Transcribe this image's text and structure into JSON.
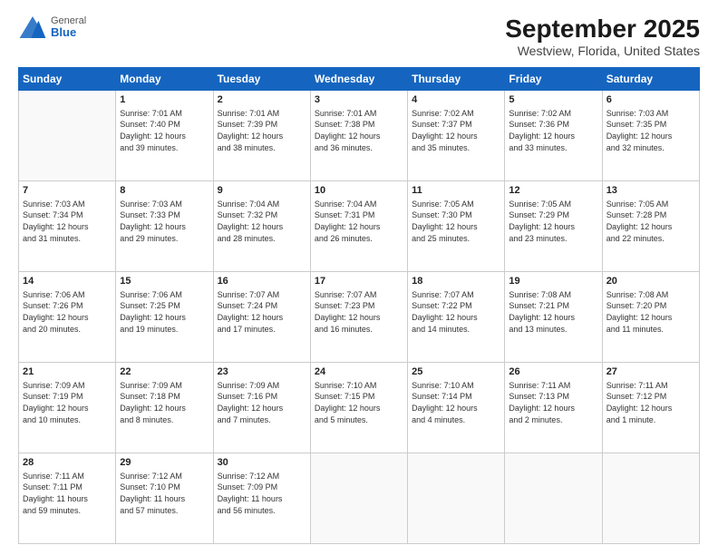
{
  "logo": {
    "general": "General",
    "blue": "Blue"
  },
  "header": {
    "title": "September 2025",
    "subtitle": "Westview, Florida, United States"
  },
  "days": [
    "Sunday",
    "Monday",
    "Tuesday",
    "Wednesday",
    "Thursday",
    "Friday",
    "Saturday"
  ],
  "weeks": [
    [
      {
        "day": "",
        "content": ""
      },
      {
        "day": "1",
        "content": "Sunrise: 7:01 AM\nSunset: 7:40 PM\nDaylight: 12 hours\nand 39 minutes."
      },
      {
        "day": "2",
        "content": "Sunrise: 7:01 AM\nSunset: 7:39 PM\nDaylight: 12 hours\nand 38 minutes."
      },
      {
        "day": "3",
        "content": "Sunrise: 7:01 AM\nSunset: 7:38 PM\nDaylight: 12 hours\nand 36 minutes."
      },
      {
        "day": "4",
        "content": "Sunrise: 7:02 AM\nSunset: 7:37 PM\nDaylight: 12 hours\nand 35 minutes."
      },
      {
        "day": "5",
        "content": "Sunrise: 7:02 AM\nSunset: 7:36 PM\nDaylight: 12 hours\nand 33 minutes."
      },
      {
        "day": "6",
        "content": "Sunrise: 7:03 AM\nSunset: 7:35 PM\nDaylight: 12 hours\nand 32 minutes."
      }
    ],
    [
      {
        "day": "7",
        "content": "Sunrise: 7:03 AM\nSunset: 7:34 PM\nDaylight: 12 hours\nand 31 minutes."
      },
      {
        "day": "8",
        "content": "Sunrise: 7:03 AM\nSunset: 7:33 PM\nDaylight: 12 hours\nand 29 minutes."
      },
      {
        "day": "9",
        "content": "Sunrise: 7:04 AM\nSunset: 7:32 PM\nDaylight: 12 hours\nand 28 minutes."
      },
      {
        "day": "10",
        "content": "Sunrise: 7:04 AM\nSunset: 7:31 PM\nDaylight: 12 hours\nand 26 minutes."
      },
      {
        "day": "11",
        "content": "Sunrise: 7:05 AM\nSunset: 7:30 PM\nDaylight: 12 hours\nand 25 minutes."
      },
      {
        "day": "12",
        "content": "Sunrise: 7:05 AM\nSunset: 7:29 PM\nDaylight: 12 hours\nand 23 minutes."
      },
      {
        "day": "13",
        "content": "Sunrise: 7:05 AM\nSunset: 7:28 PM\nDaylight: 12 hours\nand 22 minutes."
      }
    ],
    [
      {
        "day": "14",
        "content": "Sunrise: 7:06 AM\nSunset: 7:26 PM\nDaylight: 12 hours\nand 20 minutes."
      },
      {
        "day": "15",
        "content": "Sunrise: 7:06 AM\nSunset: 7:25 PM\nDaylight: 12 hours\nand 19 minutes."
      },
      {
        "day": "16",
        "content": "Sunrise: 7:07 AM\nSunset: 7:24 PM\nDaylight: 12 hours\nand 17 minutes."
      },
      {
        "day": "17",
        "content": "Sunrise: 7:07 AM\nSunset: 7:23 PM\nDaylight: 12 hours\nand 16 minutes."
      },
      {
        "day": "18",
        "content": "Sunrise: 7:07 AM\nSunset: 7:22 PM\nDaylight: 12 hours\nand 14 minutes."
      },
      {
        "day": "19",
        "content": "Sunrise: 7:08 AM\nSunset: 7:21 PM\nDaylight: 12 hours\nand 13 minutes."
      },
      {
        "day": "20",
        "content": "Sunrise: 7:08 AM\nSunset: 7:20 PM\nDaylight: 12 hours\nand 11 minutes."
      }
    ],
    [
      {
        "day": "21",
        "content": "Sunrise: 7:09 AM\nSunset: 7:19 PM\nDaylight: 12 hours\nand 10 minutes."
      },
      {
        "day": "22",
        "content": "Sunrise: 7:09 AM\nSunset: 7:18 PM\nDaylight: 12 hours\nand 8 minutes."
      },
      {
        "day": "23",
        "content": "Sunrise: 7:09 AM\nSunset: 7:16 PM\nDaylight: 12 hours\nand 7 minutes."
      },
      {
        "day": "24",
        "content": "Sunrise: 7:10 AM\nSunset: 7:15 PM\nDaylight: 12 hours\nand 5 minutes."
      },
      {
        "day": "25",
        "content": "Sunrise: 7:10 AM\nSunset: 7:14 PM\nDaylight: 12 hours\nand 4 minutes."
      },
      {
        "day": "26",
        "content": "Sunrise: 7:11 AM\nSunset: 7:13 PM\nDaylight: 12 hours\nand 2 minutes."
      },
      {
        "day": "27",
        "content": "Sunrise: 7:11 AM\nSunset: 7:12 PM\nDaylight: 12 hours\nand 1 minute."
      }
    ],
    [
      {
        "day": "28",
        "content": "Sunrise: 7:11 AM\nSunset: 7:11 PM\nDaylight: 11 hours\nand 59 minutes."
      },
      {
        "day": "29",
        "content": "Sunrise: 7:12 AM\nSunset: 7:10 PM\nDaylight: 11 hours\nand 57 minutes."
      },
      {
        "day": "30",
        "content": "Sunrise: 7:12 AM\nSunset: 7:09 PM\nDaylight: 11 hours\nand 56 minutes."
      },
      {
        "day": "",
        "content": ""
      },
      {
        "day": "",
        "content": ""
      },
      {
        "day": "",
        "content": ""
      },
      {
        "day": "",
        "content": ""
      }
    ]
  ]
}
